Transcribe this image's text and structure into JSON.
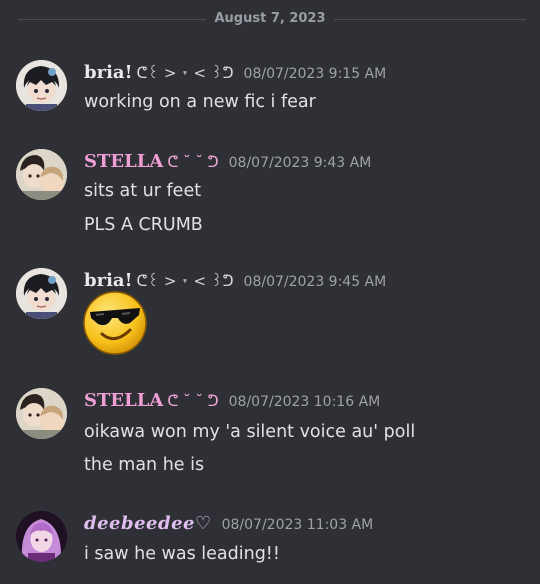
{
  "date_divider": "August 7, 2023",
  "messages": [
    {
      "username": "bria!",
      "decoration": "ᕦ꒰ > ˕ < ꒱ᕤ",
      "timestamp": "08/07/2023 9:15 AM",
      "lines": [
        "working on a new fic i fear"
      ],
      "avatar": "dark-haired-anime-character-avatar"
    },
    {
      "username": "STELLA",
      "decoration": "ᕦ ˘ ˘ ᕤ",
      "timestamp": "08/07/2023 9:43 AM",
      "lines": [
        "sits at ur feet",
        "PLS A CRUMB"
      ],
      "avatar": "anime-characters-avatar"
    },
    {
      "username": "bria!",
      "decoration": "ᕦ꒰ > ˕ < ꒱ᕤ",
      "timestamp": "08/07/2023 9:45 AM",
      "lines": [],
      "emoji": "sunglasses-emoji",
      "avatar": "dark-haired-anime-character-avatar"
    },
    {
      "username": "STELLA",
      "decoration": "ᕦ ˘ ˘ ᕤ",
      "timestamp": "08/07/2023 10:16 AM",
      "lines": [
        "oikawa won my 'a silent voice au' poll",
        "the man he is"
      ],
      "avatar": "anime-characters-avatar"
    },
    {
      "username": "deebeedee♡",
      "decoration": "",
      "timestamp": "08/07/2023 11:03 AM",
      "lines": [
        "i saw he was leading!!"
      ],
      "avatar": "purple-haired-character-avatar"
    }
  ],
  "colors": {
    "background": "#2f3035",
    "bria_name": "#e9e9ea",
    "stella_name": "#ef9fd6",
    "deebeedee_name": "#e0bff0",
    "timestamp": "#9ea1a8"
  }
}
